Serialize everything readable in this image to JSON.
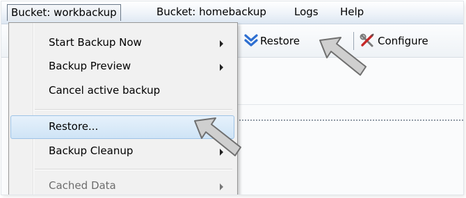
{
  "menubar": {
    "items": [
      {
        "label": "Bucket: workbackup"
      },
      {
        "label": "Bucket: homebackup"
      },
      {
        "label": "Logs"
      },
      {
        "label": "Help"
      }
    ]
  },
  "toolbar": {
    "restore_label": "Restore",
    "configure_label": "Configure"
  },
  "dropdown": {
    "items": [
      {
        "label": "Start Backup Now",
        "submenu": true
      },
      {
        "label": "Backup Preview",
        "submenu": true
      },
      {
        "label": "Cancel active backup"
      },
      {
        "label": "Restore..."
      },
      {
        "label": "Backup Cleanup",
        "submenu": true
      },
      {
        "label": "Cached Data",
        "submenu": true,
        "disabled": true
      }
    ]
  },
  "colors": {
    "highlight": "#cfe4f6",
    "menubar": "#eef3f9",
    "restore_icon": "#2e6fd1"
  },
  "icons": [
    "double-chevron-down-icon",
    "tools-icon",
    "pointer-arrow-icon",
    "submenu-arrow-icon"
  ]
}
